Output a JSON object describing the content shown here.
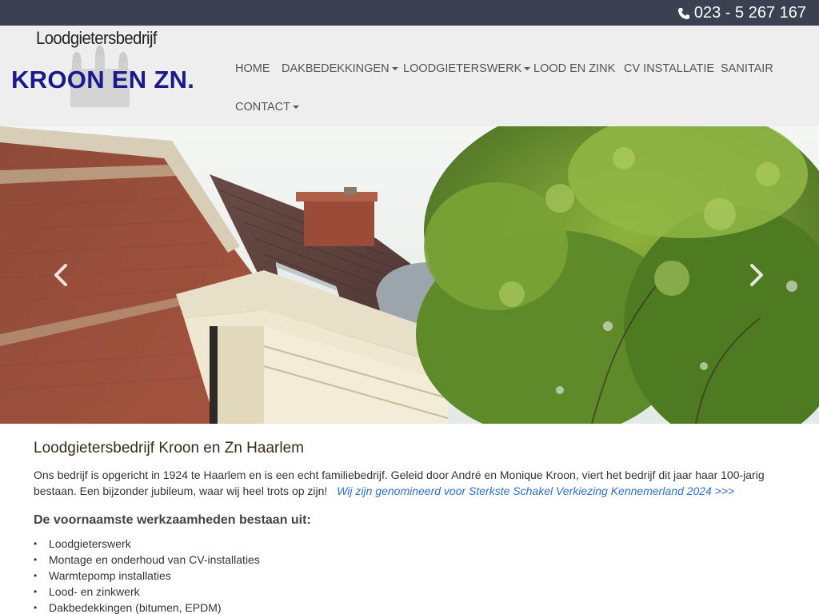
{
  "topbar": {
    "phone_number": "023 - 5 267 167",
    "phone_icon": "phone-icon"
  },
  "logo": {
    "tagline": "Loodgietersbedrijf",
    "brand": "KROON EN ZN.",
    "brand_color": "#1b1a8c"
  },
  "nav": {
    "items": [
      {
        "label": "HOME",
        "has_dropdown": false
      },
      {
        "label": "DAKBEDEKKINGEN",
        "has_dropdown": true
      },
      {
        "label": "LOODGIETERSWERK",
        "has_dropdown": true
      },
      {
        "label": "LOOD EN ZINK",
        "has_dropdown": false
      },
      {
        "label": "CV INSTALLATIE",
        "has_dropdown": false
      },
      {
        "label": "SANITAIR",
        "has_dropdown": false
      },
      {
        "label": "CONTACT",
        "has_dropdown": true
      }
    ]
  },
  "hero": {
    "prev_icon": "chevron-left-icon",
    "next_icon": "chevron-right-icon"
  },
  "main": {
    "title": "Loodgietersbedrijf Kroon en Zn Haarlem",
    "intro": "Ons bedrijf is opgericht in 1924 te Haarlem en is een echt familiebedrijf. Geleid door André en Monique Kroon, viert het bedrijf dit jaar haar 100-jarig bestaan. Een bijzonder jubileum, waar wij heel trots op zijn!",
    "link_text": "Wij zijn genomineerd voor Sterkste Schakel Verkiezing Kennemerland 2024 >>>",
    "subtitle": "De voornaamste werkzaamheden bestaan uit:",
    "services": [
      "Loodgieterswerk",
      "Montage en onderhoud van CV-installaties",
      "Warmtepomp installaties",
      "Lood- en zinkwerk",
      "Dakbedekkingen (bitumen, EPDM)"
    ]
  },
  "colors": {
    "topbar_bg": "#3b4150",
    "header_bg": "#eeeeee",
    "link": "#2a6fd6"
  }
}
